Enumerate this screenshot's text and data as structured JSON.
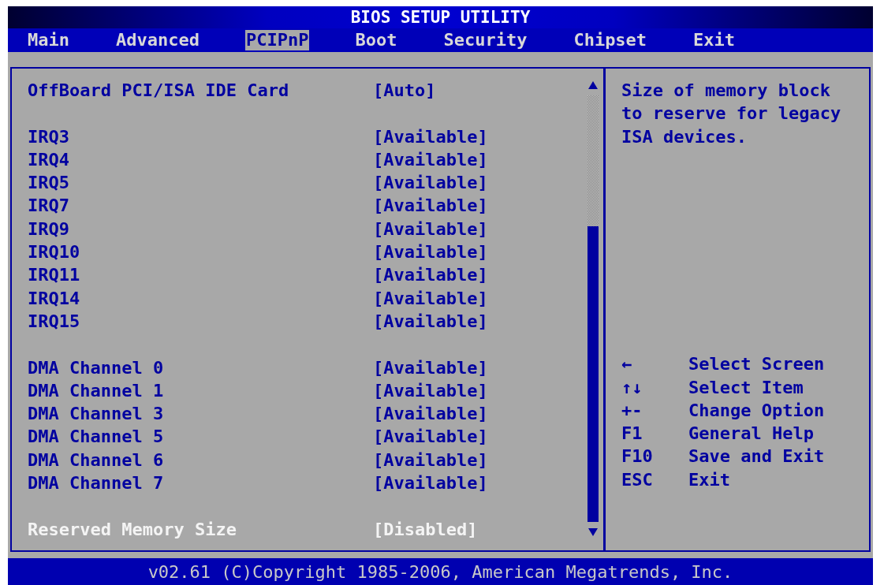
{
  "window": {
    "title": "BIOS SETUP UTILITY"
  },
  "tabs": [
    {
      "label": "Main",
      "selected": false
    },
    {
      "label": "Advanced",
      "selected": false
    },
    {
      "label": "PCIPnP",
      "selected": true
    },
    {
      "label": "Boot",
      "selected": false
    },
    {
      "label": "Security",
      "selected": false
    },
    {
      "label": "Chipset",
      "selected": false
    },
    {
      "label": "Exit",
      "selected": false
    }
  ],
  "sections": [
    {
      "items": [
        {
          "label": "OffBoard PCI/ISA IDE Card",
          "value": "[Auto]",
          "selected": false
        }
      ]
    },
    {
      "items": [
        {
          "label": "IRQ3",
          "value": "[Available]",
          "selected": false
        },
        {
          "label": "IRQ4",
          "value": "[Available]",
          "selected": false
        },
        {
          "label": "IRQ5",
          "value": "[Available]",
          "selected": false
        },
        {
          "label": "IRQ7",
          "value": "[Available]",
          "selected": false
        },
        {
          "label": "IRQ9",
          "value": "[Available]",
          "selected": false
        },
        {
          "label": "IRQ10",
          "value": "[Available]",
          "selected": false
        },
        {
          "label": "IRQ11",
          "value": "[Available]",
          "selected": false
        },
        {
          "label": "IRQ14",
          "value": "[Available]",
          "selected": false
        },
        {
          "label": "IRQ15",
          "value": "[Available]",
          "selected": false
        }
      ]
    },
    {
      "items": [
        {
          "label": "DMA Channel 0",
          "value": "[Available]",
          "selected": false
        },
        {
          "label": "DMA Channel 1",
          "value": "[Available]",
          "selected": false
        },
        {
          "label": "DMA Channel 3",
          "value": "[Available]",
          "selected": false
        },
        {
          "label": "DMA Channel 5",
          "value": "[Available]",
          "selected": false
        },
        {
          "label": "DMA Channel 6",
          "value": "[Available]",
          "selected": false
        },
        {
          "label": "DMA Channel 7",
          "value": "[Available]",
          "selected": false
        }
      ]
    },
    {
      "items": [
        {
          "label": "Reserved Memory Size",
          "value": "[Disabled]",
          "selected": true
        }
      ]
    }
  ],
  "help": "Size of memory block to reserve for legacy ISA devices.",
  "legend": [
    {
      "key": "←",
      "action": "Select Screen"
    },
    {
      "key": "↑↓",
      "action": "Select Item"
    },
    {
      "key": "+-",
      "action": "Change Option"
    },
    {
      "key": "F1",
      "action": "General Help"
    },
    {
      "key": "F10",
      "action": "Save and Exit"
    },
    {
      "key": "ESC",
      "action": "Exit"
    }
  ],
  "status_bar": "v02.61 (C)Copyright 1985-2006, American Megatrends, Inc."
}
